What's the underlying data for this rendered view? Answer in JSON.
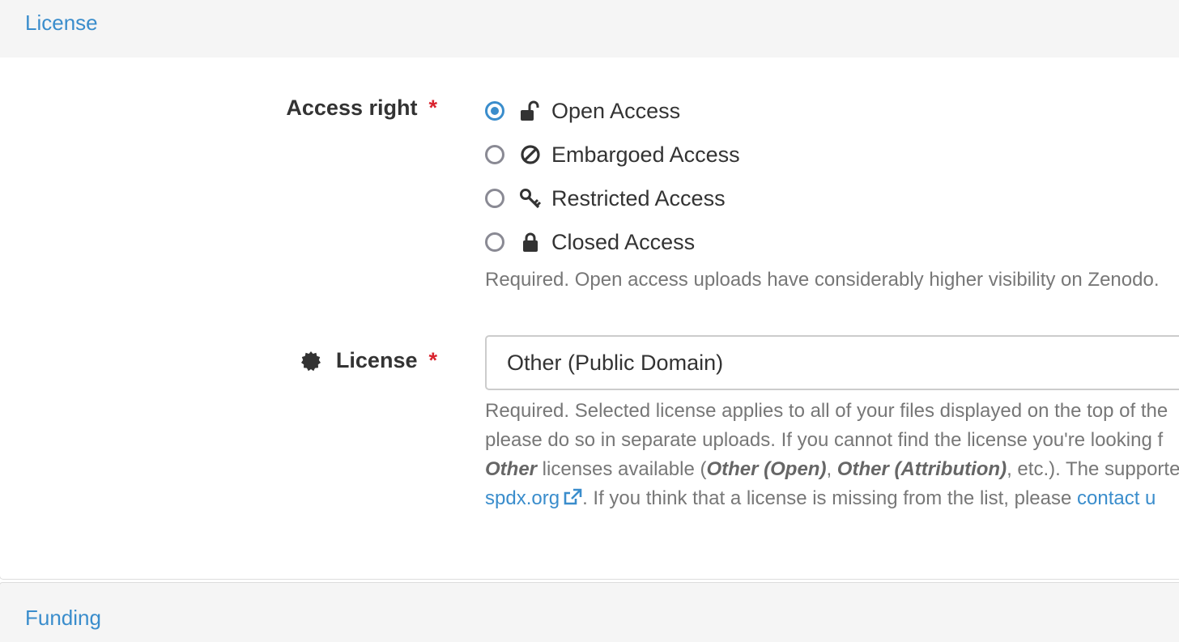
{
  "panels": {
    "license_title": "License",
    "funding_title": "Funding"
  },
  "access_right": {
    "label": "Access right",
    "required_mark": "*",
    "options": [
      {
        "label": "Open Access",
        "icon": "unlock-icon",
        "checked": true
      },
      {
        "label": "Embargoed Access",
        "icon": "ban-icon",
        "checked": false
      },
      {
        "label": "Restricted Access",
        "icon": "key-icon",
        "checked": false
      },
      {
        "label": "Closed Access",
        "icon": "lock-icon",
        "checked": false
      }
    ],
    "help": "Required. Open access uploads have considerably higher visibility on Zenodo."
  },
  "license": {
    "label": "License",
    "required_mark": "*",
    "label_icon": "certificate-icon",
    "value": "Other (Public Domain)",
    "help_line1": "Required. Selected license applies to all of your files displayed on the top of the",
    "help_line2": "please do so in separate uploads. If you cannot find the license you're looking f",
    "help_line3_em1": "Other",
    "help_line3_text1": " licenses available (",
    "help_line3_em2": "Other (Open)",
    "help_line3_text2": ", ",
    "help_line3_em3": "Other (Attribution)",
    "help_line3_text3": ", etc.). The supported",
    "help_line4_link": "spdx.org",
    "help_line4_text": ". If you think that a license is missing from the list, please ",
    "help_line4_contact": "contact u"
  },
  "colors": {
    "accent": "#3a8dcc",
    "required": "#d9232e",
    "help_text": "#777777"
  }
}
